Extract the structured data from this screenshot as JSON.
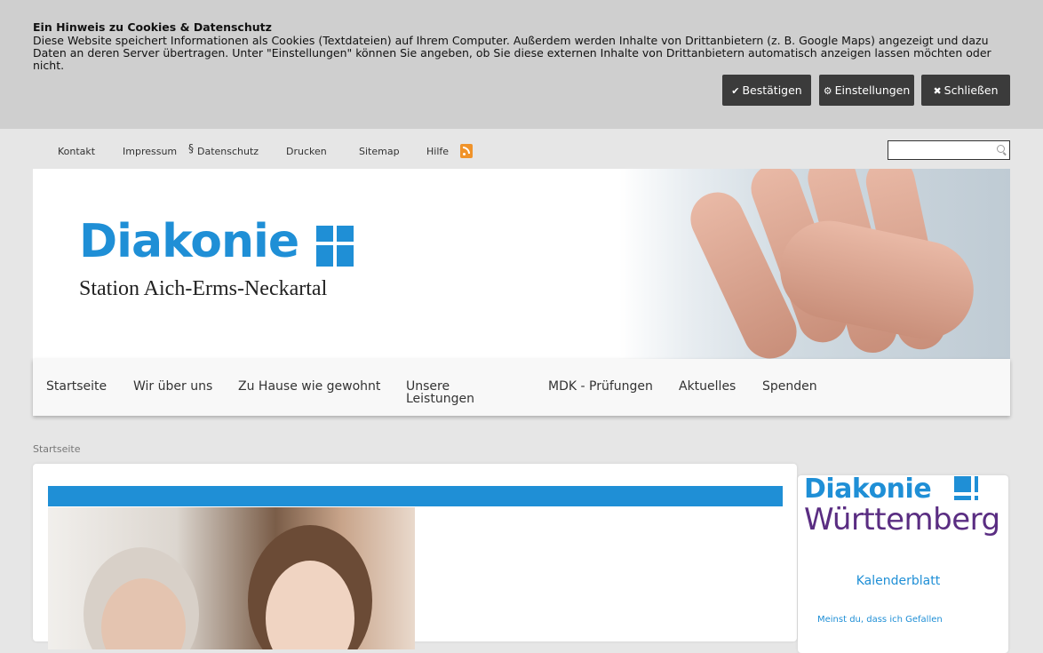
{
  "cookie": {
    "title": "Ein Hinweis zu Cookies & Datenschutz",
    "text": "Diese Website speichert Informationen als Cookies (Textdateien) auf Ihrem Computer. Außerdem werden Inhalte von Drittanbietern (z. B. Google Maps) angezeigt und dazu Daten an deren Server übertragen. Unter \"Einstellungen\" können Sie angeben, ob Sie diese externen Inhalte von Drittanbietern automatisch anzeigen lassen möchten oder nicht.",
    "confirm_label": "Bestätigen",
    "confirm_icon": "✔",
    "settings_label": "Einstellungen",
    "settings_icon": "⚙",
    "close_label": "Schließen",
    "close_icon": "✖"
  },
  "topnav": {
    "items": [
      "Kontakt",
      "Impressum",
      "Datenschutz",
      "Drucken",
      "Sitemap",
      "Hilfe"
    ],
    "paragraph_symbol": "§"
  },
  "header": {
    "logo_word": "Diakonie",
    "logo_sub": "Station Aich-Erms-Neckartal"
  },
  "mainnav": {
    "items": [
      "Startseite",
      "Wir über uns",
      "Zu Hause wie gewohnt",
      "Unsere Leistungen",
      "MDK - Prüfungen",
      "Aktuelles",
      "Spenden"
    ]
  },
  "breadcrumb": "Startseite",
  "sidebar": {
    "logo_line1": "Diakonie",
    "logo_line2": "Württemberg",
    "kalender": "Kalenderblatt",
    "teaser": "Meinst du, dass ich Gefallen"
  },
  "colors": {
    "brand_blue": "#1f8fd6",
    "brand_purple": "#5a2d82",
    "rss_orange": "#f0932a"
  }
}
